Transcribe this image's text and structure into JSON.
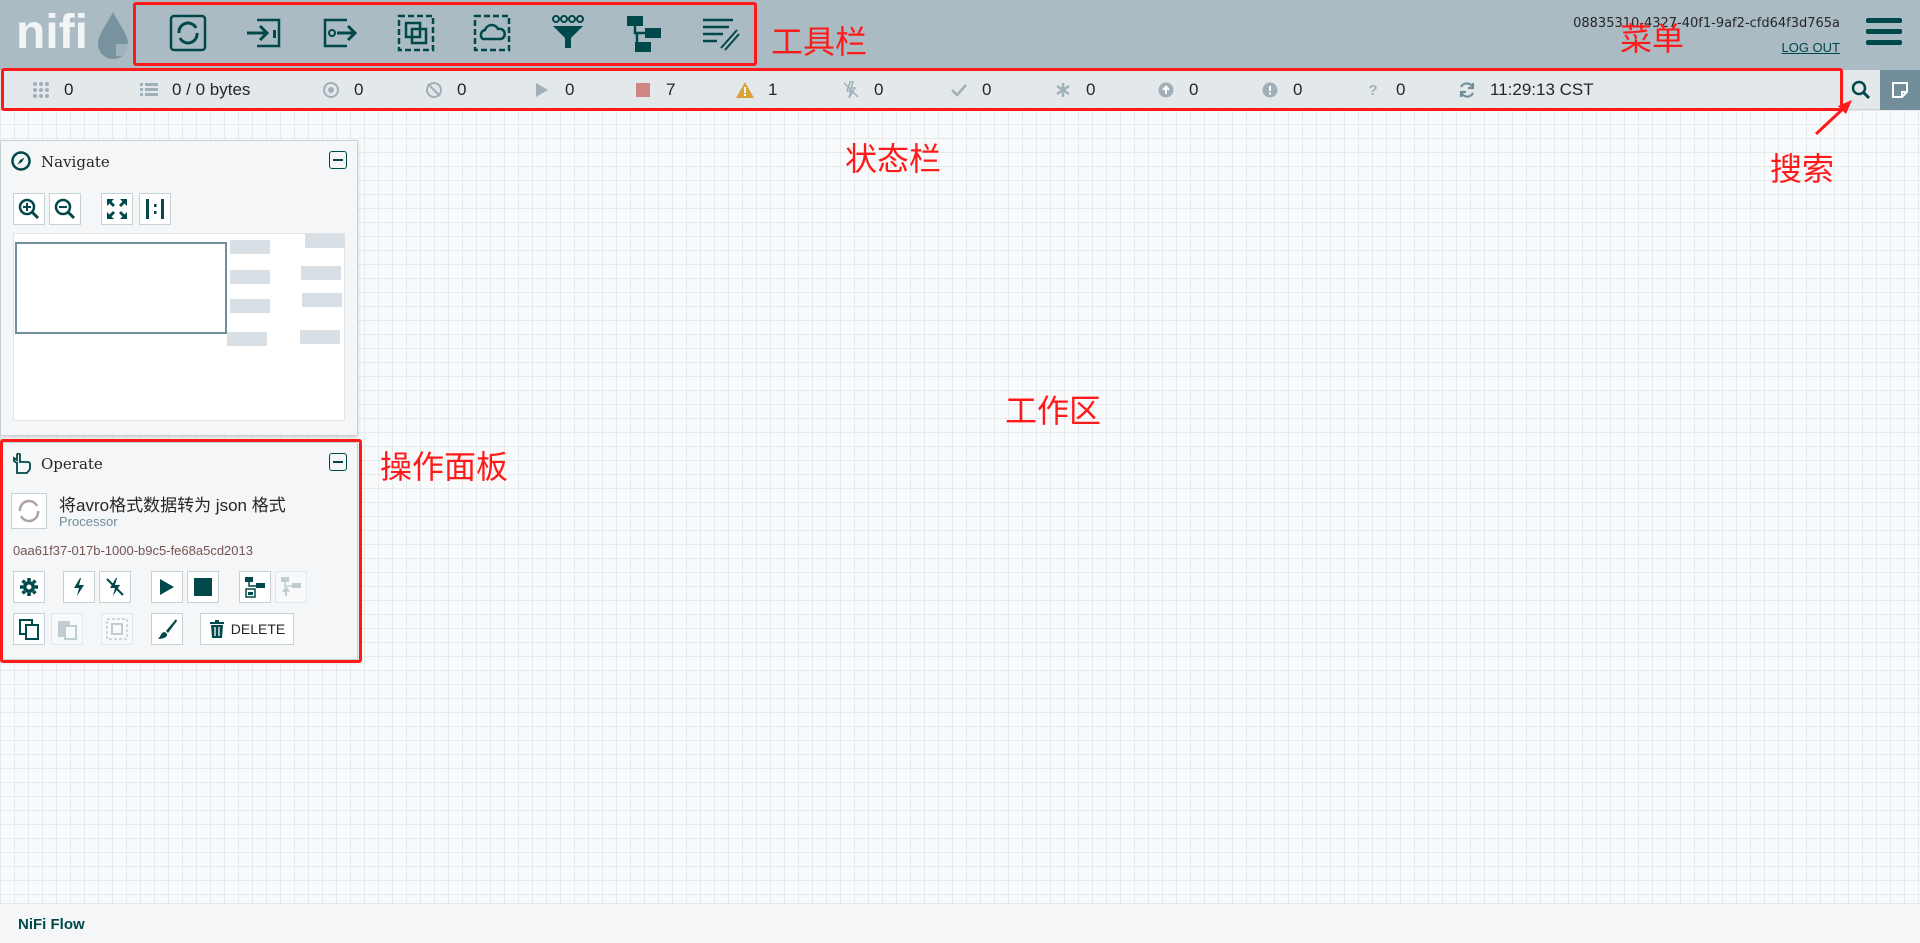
{
  "colors": {
    "header_bg": "#aabbc3",
    "statusbar_bg": "#e3e8eb",
    "icon_teal": "#004849",
    "annotation_red": "#ff1a1a",
    "stopped_red": "#ba554a",
    "warning_orange": "#d8a43a"
  },
  "header": {
    "logo_text": "nifi",
    "user_id": "08835310-4327-40f1-9af2-cfd64f3d765a",
    "logout_label": "LOG OUT",
    "toolbar": [
      {
        "icon": "processor-icon"
      },
      {
        "icon": "input-port-icon"
      },
      {
        "icon": "output-port-icon"
      },
      {
        "icon": "process-group-icon"
      },
      {
        "icon": "remote-process-group-icon"
      },
      {
        "icon": "funnel-icon"
      },
      {
        "icon": "template-icon"
      },
      {
        "icon": "label-icon"
      }
    ]
  },
  "status": {
    "threads": "0",
    "queued": "0 / 0 bytes",
    "transmitting": "0",
    "not_transmitting": "0",
    "running": "0",
    "stopped": "7",
    "invalid": "1",
    "disabled": "0",
    "up_to_date": "0",
    "locally_modified": "0",
    "stale": "0",
    "sync_failure": "0",
    "unknown": "0",
    "refreshed": "11:29:13 CST"
  },
  "navigate": {
    "title": "Navigate"
  },
  "operate": {
    "title": "Operate",
    "component_name": "将avro格式数据转为 json 格式",
    "component_type": "Processor",
    "component_id": "0aa61f37-017b-1000-b9c5-fe68a5cd2013",
    "delete_label": "DELETE"
  },
  "annotations": {
    "toolbar": "工具栏",
    "menu": "菜单",
    "statusbar": "状态栏",
    "search": "搜索",
    "workspace": "工作区",
    "operate_panel": "操作面板"
  },
  "footer": {
    "breadcrumb": "NiFi Flow"
  }
}
